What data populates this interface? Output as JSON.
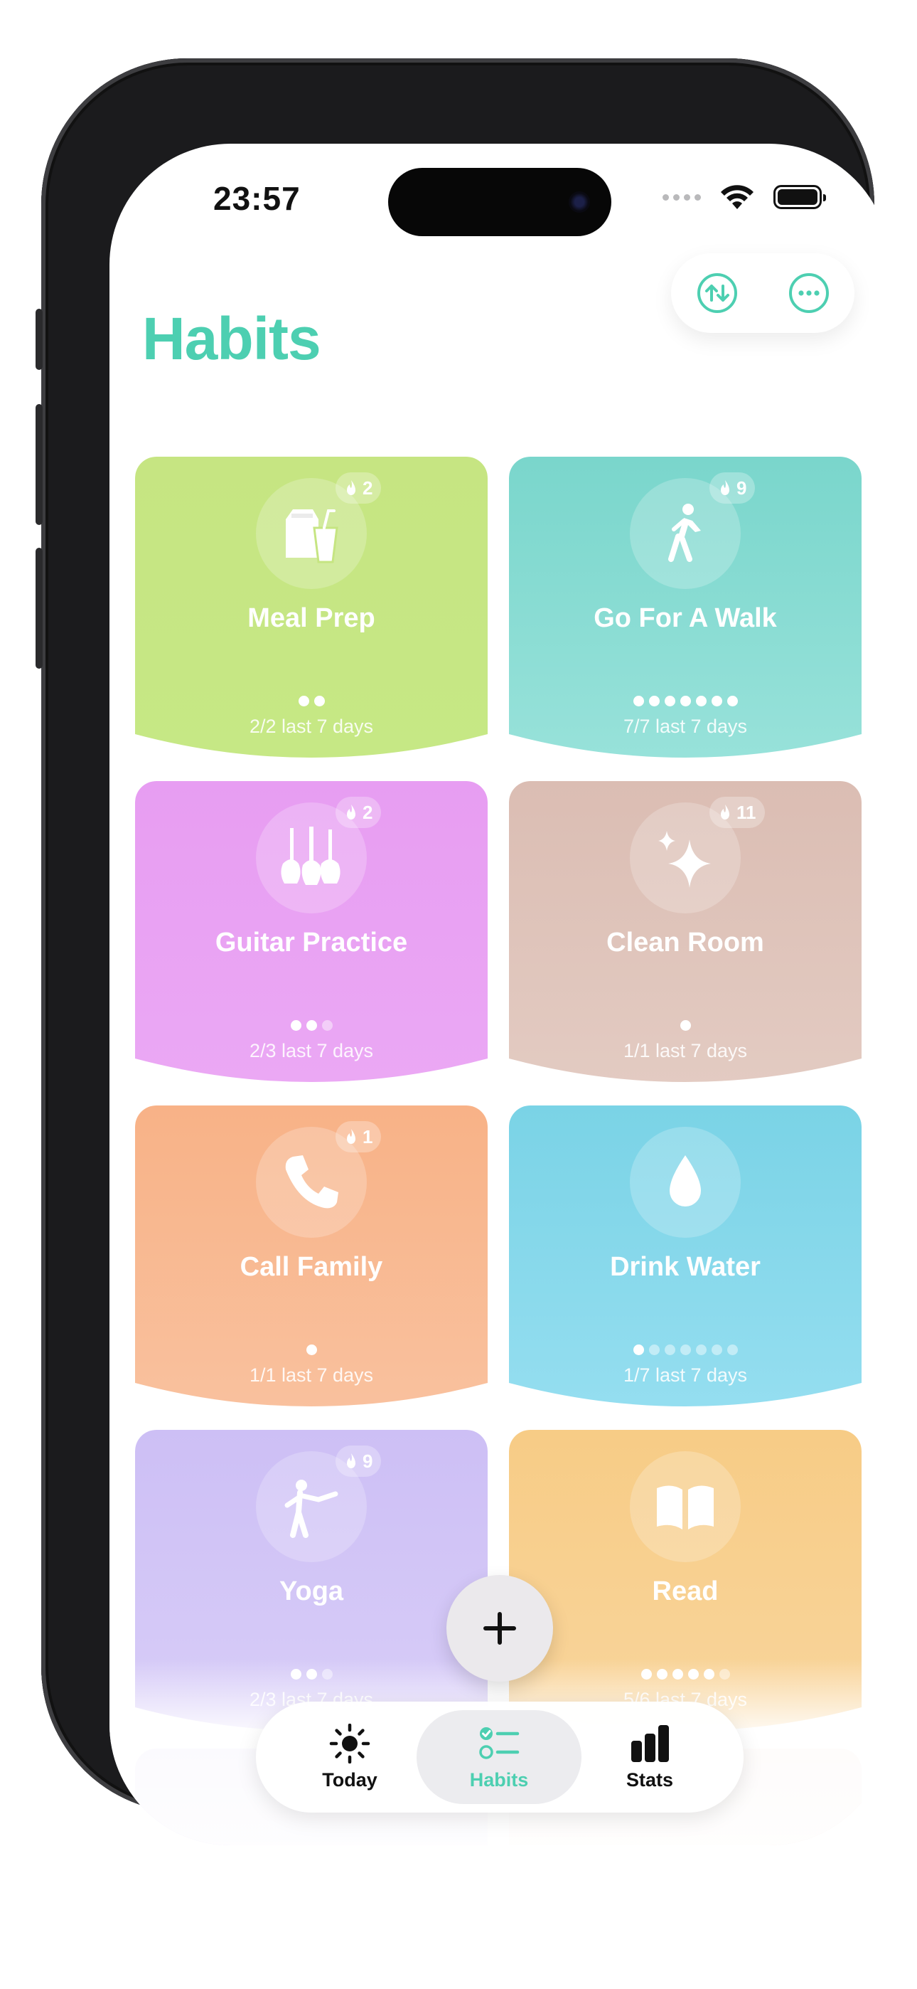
{
  "status_bar": {
    "time": "23:57"
  },
  "top_actions": {
    "sort_icon": "arrows-up-down-circle-icon",
    "more_icon": "ellipsis-circle-icon"
  },
  "page": {
    "title": "Habits"
  },
  "habits": [
    {
      "name": "Meal Prep",
      "icon": "bag-and-cup-icon",
      "streak": "2",
      "completed": 2,
      "total": 2,
      "caption": "2/2 last 7 days",
      "color_top": "#c6e582",
      "color_bottom": "#c6e885"
    },
    {
      "name": "Go For A Walk",
      "icon": "walking-figure-icon",
      "streak": "9",
      "completed": 7,
      "total": 7,
      "caption": "7/7 last 7 days",
      "color_top": "#7ad6cc",
      "color_bottom": "#98e2da"
    },
    {
      "name": "Guitar Practice",
      "icon": "guitars-icon",
      "streak": "2",
      "completed": 2,
      "total": 3,
      "caption": "2/3 last 7 days",
      "color_top": "#e79df2",
      "color_bottom": "#eba8f4"
    },
    {
      "name": "Clean Room",
      "icon": "sparkles-icon",
      "streak": "11",
      "completed": 1,
      "total": 1,
      "caption": "1/1 last 7 days",
      "color_top": "#dbbdb3",
      "color_bottom": "#e3cbc2"
    },
    {
      "name": "Call Family",
      "icon": "phone-icon",
      "streak": "1",
      "completed": 1,
      "total": 1,
      "caption": "1/1 last 7 days",
      "color_top": "#f8b287",
      "color_bottom": "#f9c19e"
    },
    {
      "name": "Drink Water",
      "icon": "water-drop-icon",
      "streak": "",
      "completed": 1,
      "total": 7,
      "caption": "1/7 last 7 days",
      "color_top": "#7ad3e6",
      "color_bottom": "#95def0"
    },
    {
      "name": "Yoga",
      "icon": "yoga-pose-icon",
      "streak": "9",
      "completed": 2,
      "total": 3,
      "caption": "2/3 last 7 days",
      "color_top": "#cdbff5",
      "color_bottom": "#d8cdf8"
    },
    {
      "name": "Read",
      "icon": "open-book-icon",
      "streak": "",
      "completed": 5,
      "total": 6,
      "caption": "5/6 last 7 days",
      "color_top": "#f7cc86",
      "color_bottom": "#f9d59c"
    }
  ],
  "partial_cards": [
    {
      "color": "#e3dcf8"
    },
    {
      "color": "#f8e6e2"
    }
  ],
  "fab": {
    "icon": "plus-icon"
  },
  "tab_bar": {
    "tabs": [
      {
        "label": "Today",
        "icon": "sun-icon",
        "active": false
      },
      {
        "label": "Habits",
        "icon": "checklist-icon",
        "active": true
      },
      {
        "label": "Stats",
        "icon": "bar-chart-icon",
        "active": false
      }
    ],
    "accent": "#4dcfb1"
  }
}
